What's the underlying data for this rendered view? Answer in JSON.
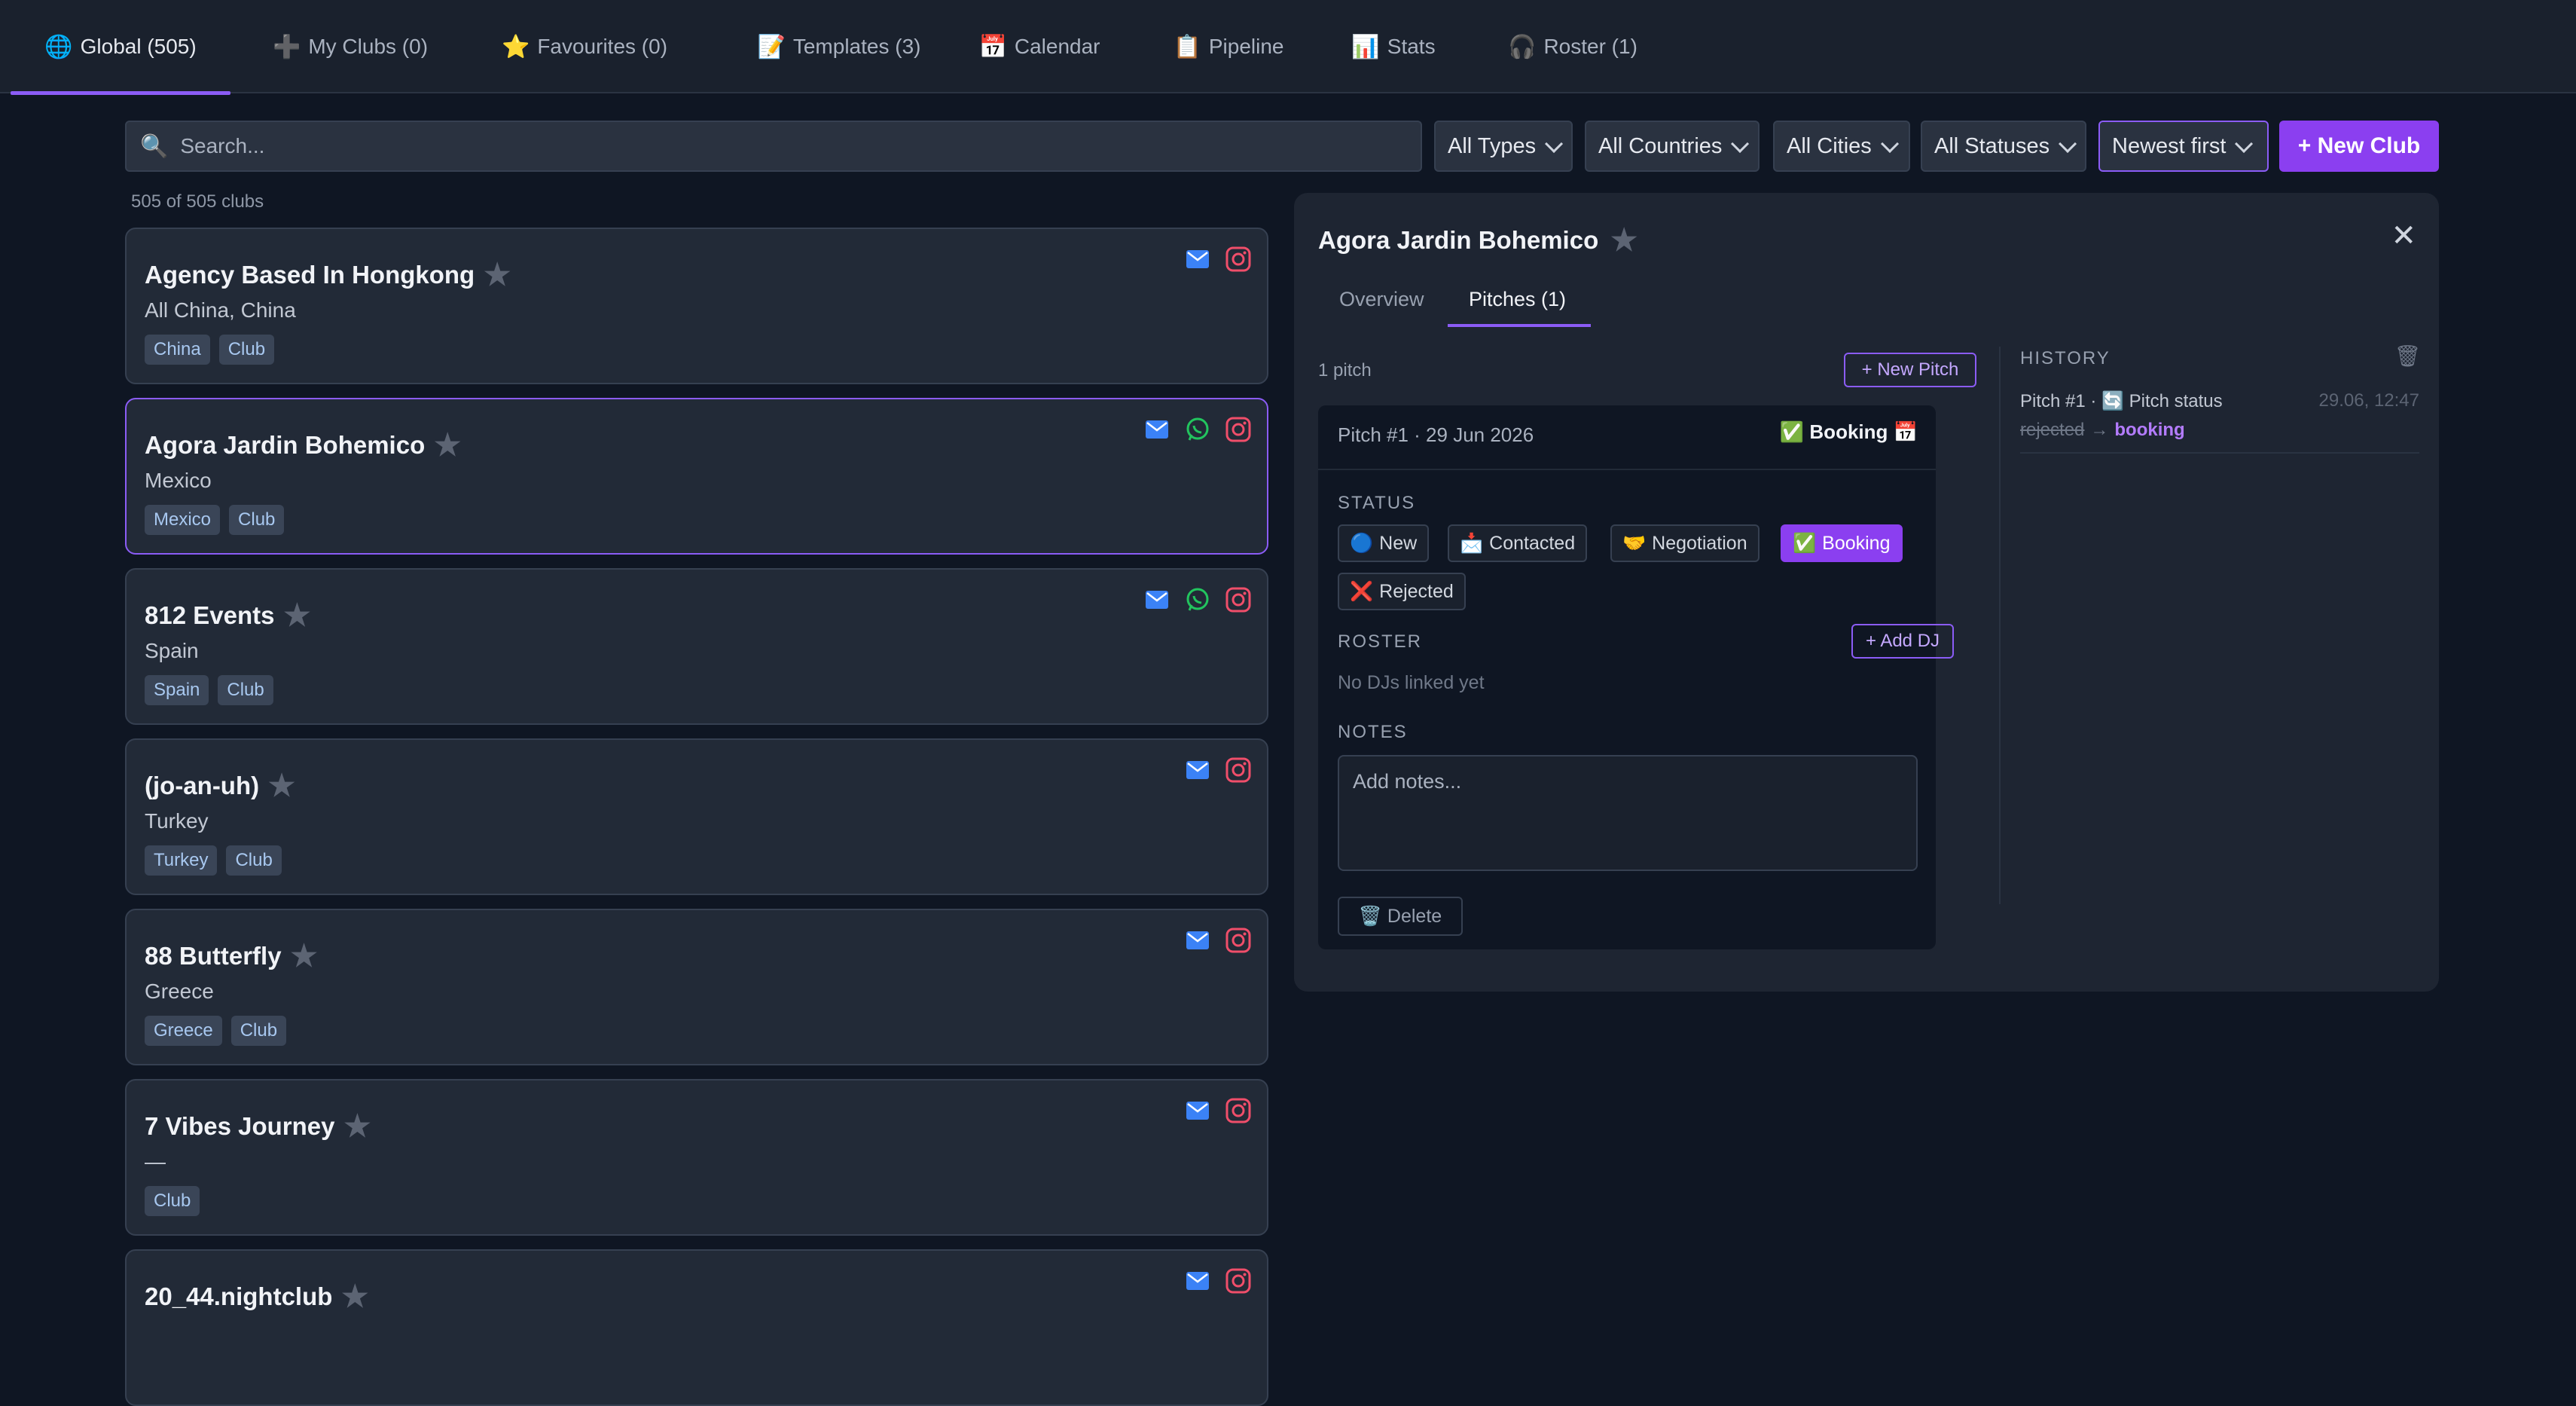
{
  "tabs": [
    {
      "icon": "🌐",
      "label": "Global (505)"
    },
    {
      "icon": "➕",
      "label": "My Clubs (0)"
    },
    {
      "icon": "⭐",
      "label": "Favourites (0)"
    },
    {
      "icon": "📝",
      "label": "Templates (3)"
    },
    {
      "icon": "📅",
      "label": "Calendar"
    },
    {
      "icon": "📋",
      "label": "Pipeline"
    },
    {
      "icon": "📊",
      "label": "Stats"
    },
    {
      "icon": "🎧",
      "label": "Roster (1)"
    }
  ],
  "toolbar": {
    "search_icon": "🔍",
    "search_placeholder": "Search...",
    "filters": [
      "All Types",
      "All Countries",
      "All Cities",
      "All Statuses"
    ],
    "sort": "Newest first",
    "new_club_label": "+ New Club"
  },
  "list": {
    "count_text": "505 of 505 clubs",
    "clubs": [
      {
        "name": "Agency Based In Hongkong",
        "location": "All China, China",
        "tags": [
          "China",
          "Club"
        ]
      },
      {
        "name": "Agora Jardin Bohemico",
        "location": "Mexico",
        "tags": [
          "Mexico",
          "Club"
        ]
      },
      {
        "name": "812 Events",
        "location": "Spain",
        "tags": [
          "Spain",
          "Club"
        ]
      },
      {
        "name": "(jo-an-uh)",
        "location": "Turkey",
        "tags": [
          "Turkey",
          "Club"
        ]
      },
      {
        "name": "88 Butterfly",
        "location": "Greece",
        "tags": [
          "Greece",
          "Club"
        ]
      },
      {
        "name": "7 Vibes Journey",
        "location": "—",
        "tags": [
          "Club"
        ]
      },
      {
        "name": "20_44.nightclub",
        "location": "",
        "tags": []
      }
    ]
  },
  "detail": {
    "title": "Agora Jardin Bohemico",
    "close_icon": "✕",
    "tabs": [
      "Overview",
      "Pitches (1)"
    ],
    "pitch_count": "1 pitch",
    "new_pitch_label": "+ New Pitch",
    "pitch": {
      "header": "Pitch #1 · 29 Jun 2026",
      "status_display": "✅ Booking 📅",
      "status_label": "STATUS",
      "statuses": [
        {
          "icon": "🔵",
          "label": "New"
        },
        {
          "icon": "📩",
          "label": "Contacted"
        },
        {
          "icon": "🤝",
          "label": "Negotiation"
        },
        {
          "icon": "✅",
          "label": "Booking"
        },
        {
          "icon": "❌",
          "label": "Rejected"
        }
      ],
      "roster_label": "ROSTER",
      "add_dj_label": "+ Add DJ",
      "roster_empty": "No DJs linked yet",
      "notes_label": "NOTES",
      "notes_placeholder": "Add notes...",
      "delete_label": "🗑️ Delete"
    },
    "history": {
      "label": "HISTORY",
      "entry": {
        "title": "Pitch #1 · 🔄 Pitch status",
        "time": "29.06, 12:47",
        "from": "rejected",
        "arrow": "→",
        "to": "booking"
      }
    }
  },
  "colors": {
    "accent": "#8b5cf6",
    "primary_button": "#8b3ff0",
    "background": "#0f1623",
    "card": "#222a37"
  }
}
